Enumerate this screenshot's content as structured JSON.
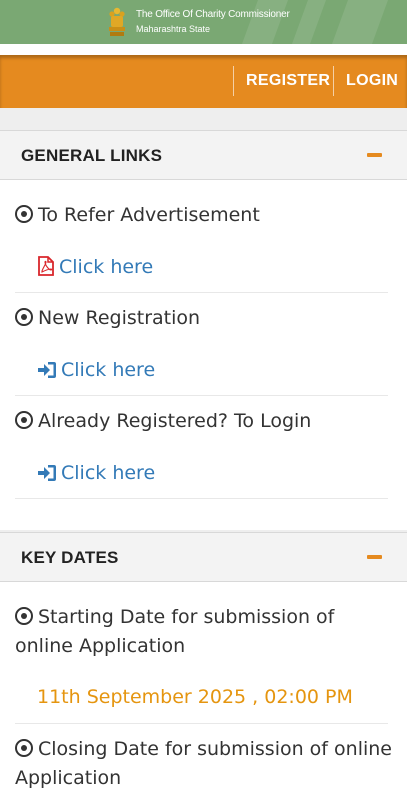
{
  "banner": {
    "title": "The Office Of Charity Commissioner",
    "subtitle": "Maharashtra State"
  },
  "nav": {
    "register_label": "REGISTER",
    "login_label": "LOGIN"
  },
  "general_links": {
    "heading": "GENERAL LINKS",
    "items": [
      {
        "title": "To Refer Advertisement",
        "link_label": "Click here",
        "link_icon": "pdf-icon"
      },
      {
        "title": "New Registration",
        "link_label": "Click here",
        "link_icon": "sign-in-icon"
      },
      {
        "title": "Already Registered? To Login",
        "link_label": "Click here",
        "link_icon": "sign-in-icon"
      }
    ]
  },
  "key_dates": {
    "heading": "KEY DATES",
    "items": [
      {
        "title": "Starting Date for submission of online Application",
        "value": "11th September 2025 , 02:00 PM"
      },
      {
        "title": "Closing Date for submission of online Application"
      }
    ]
  },
  "colors": {
    "banner_green": "#7aa873",
    "nav_orange": "#e58a1f",
    "link_blue": "#337ab7",
    "date_orange": "#e5950f",
    "pdf_red": "#d9262b"
  }
}
